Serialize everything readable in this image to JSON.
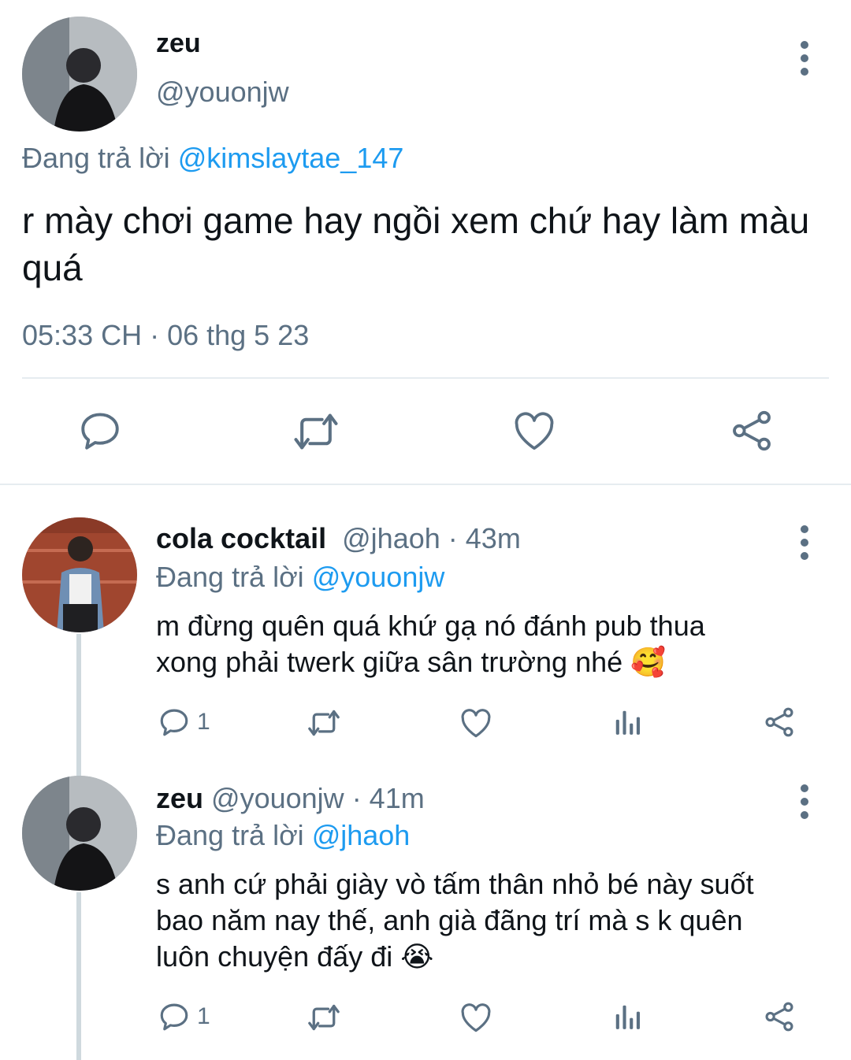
{
  "main_tweet": {
    "author_name": "zeu",
    "author_handle": "@youonjw",
    "replying_prefix": "Đang trả lời",
    "replying_to": "@kimslaytae_147",
    "text": "r mày chơi game hay ngồi xem chứ hay làm màu quá",
    "timestamp": "05:33 CH · 06 thg 5 23",
    "actions": [
      "reply-icon",
      "retweet-icon",
      "like-icon",
      "share-icon"
    ]
  },
  "replies": [
    {
      "author_name": "cola cocktail",
      "author_handle": "@jhaoh",
      "time_ago": "· 43m",
      "replying_prefix": "Đang trả lời",
      "replying_to": "@youonjw",
      "text_line1": "m đừng quên quá khứ gạ nó đánh pub thua",
      "text_line2": "xong phải twerk giữa sân trường nhé",
      "emoji": "🥰",
      "reply_count": "1"
    },
    {
      "author_name": "zeu",
      "author_handle": "@youonjw",
      "time_ago": "· 41m",
      "replying_prefix": "Đang trả lời",
      "replying_to": "@jhaoh",
      "text_line1": "s anh cứ phải giày vò tấm thân nhỏ bé này suốt",
      "text_line2": "bao năm nay thế, anh già đãng trí mà s k quên",
      "text_line3": "luôn chuyện đấy đi",
      "emoji": "😭",
      "reply_count": "1"
    }
  ],
  "colors": {
    "accent": "#1d9bf0",
    "muted": "#5b7083",
    "divider": "#e6ecf0",
    "thread_line": "#cfd9de"
  }
}
